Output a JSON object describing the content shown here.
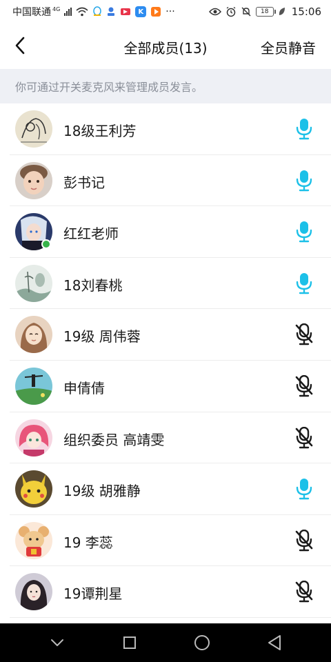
{
  "status_bar": {
    "carrier": "中国联通",
    "network": "4G",
    "more": "···",
    "battery": "18",
    "time": "15:06"
  },
  "header": {
    "title": "全部成员(13)",
    "mute_all": "全员静音"
  },
  "hint": "你可通过开关麦克风来管理成员发言。",
  "colors": {
    "mic_on": "#1cc0e8",
    "mic_off": "#1a1a1a",
    "hint_bg": "#eef0f5",
    "hint_text": "#8a8f99"
  },
  "members": [
    {
      "name": "18级王利芳",
      "mic": "on",
      "avatar": "sketch-avatar"
    },
    {
      "name": "彭书记",
      "mic": "on",
      "avatar": "child-avatar"
    },
    {
      "name": "红红老师",
      "mic": "on",
      "avatar": "anime-girl-avatar",
      "online": true
    },
    {
      "name": "18刘春桃",
      "mic": "on",
      "avatar": "ink-painting-avatar"
    },
    {
      "name": "19级 周伟蓉",
      "mic": "off",
      "avatar": "drawn-girl-avatar"
    },
    {
      "name": "申倩倩",
      "mic": "off",
      "avatar": "landscape-avatar"
    },
    {
      "name": "组织委员 高靖雯",
      "mic": "off",
      "avatar": "pink-anime-avatar"
    },
    {
      "name": "19级 胡雅静",
      "mic": "on",
      "avatar": "pikachu-avatar"
    },
    {
      "name": "19 李蕊",
      "mic": "off",
      "avatar": "cartoon-mouse-avatar"
    },
    {
      "name": "19谭荆星",
      "mic": "off",
      "avatar": "portrait-avatar"
    }
  ]
}
